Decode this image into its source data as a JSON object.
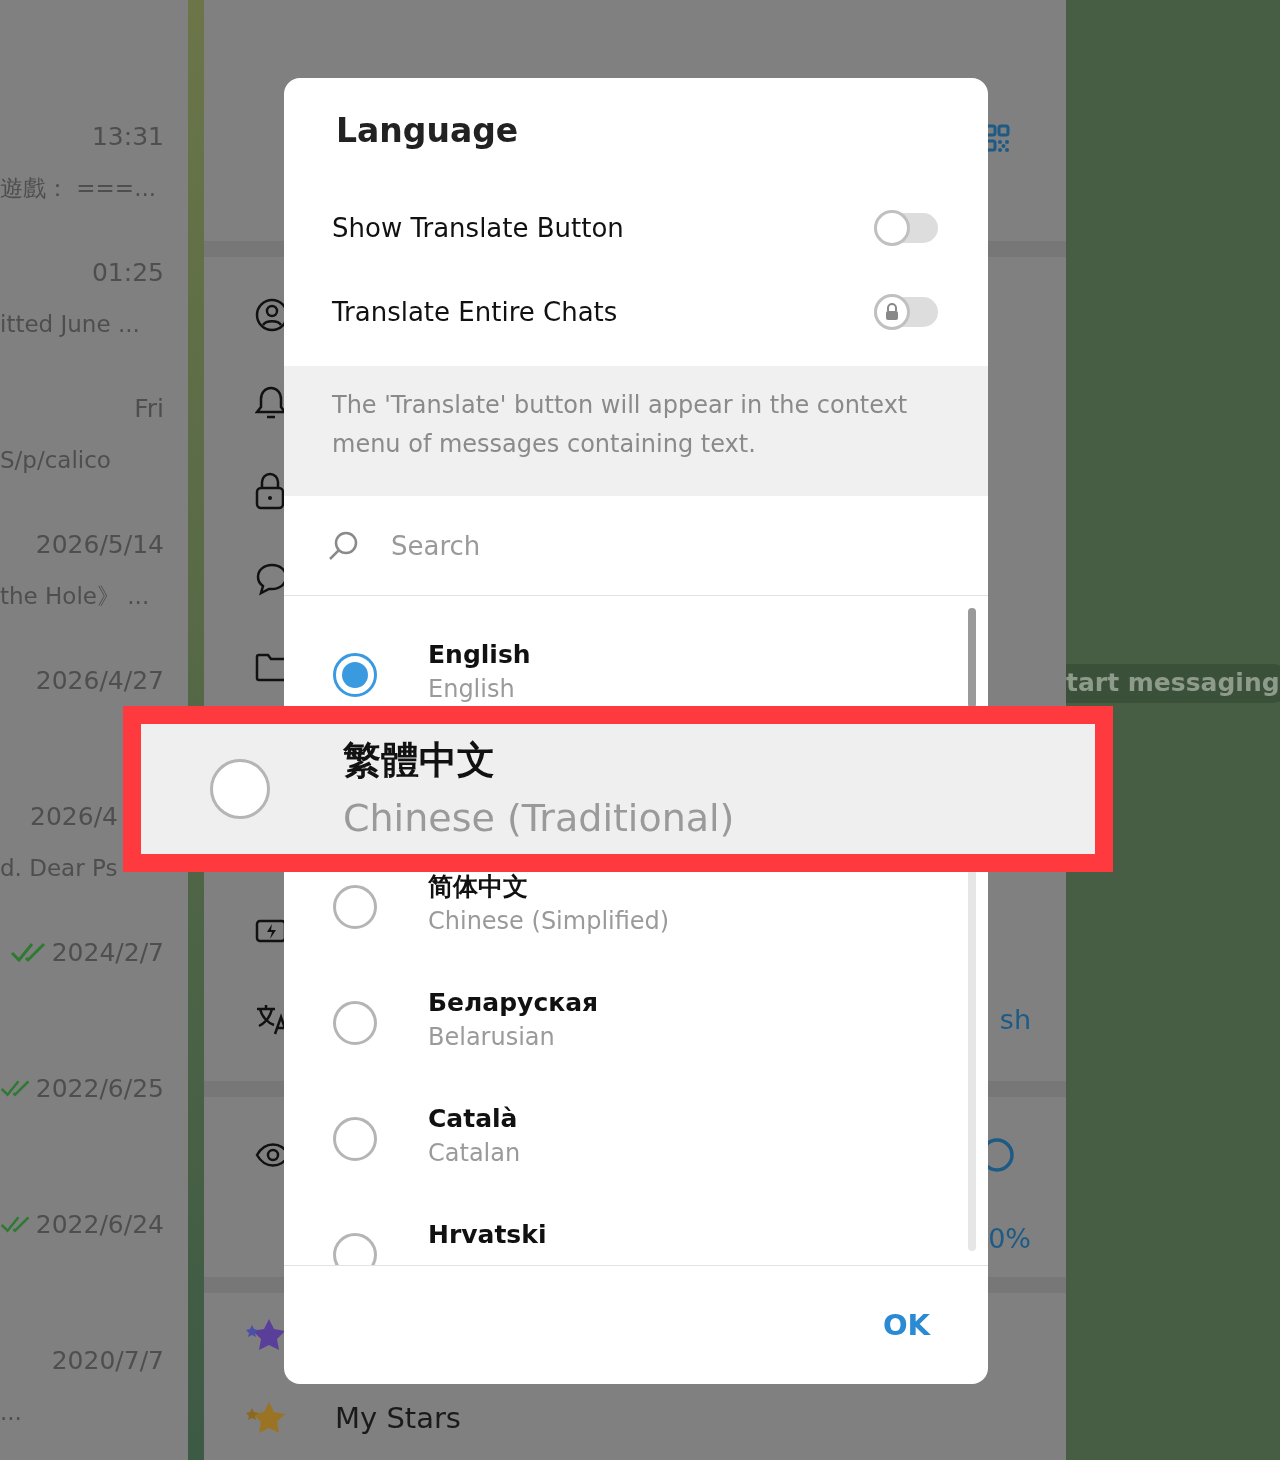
{
  "chat_list": {
    "items": [
      {
        "time": "13:31",
        "snippet": "遊戲： ===...",
        "read": false
      },
      {
        "time": "01:25",
        "snippet": "itted June ...",
        "read": false
      },
      {
        "time": "Fri",
        "snippet": "S/p/calico",
        "read": false
      },
      {
        "time": "2026/5/14",
        "snippet": "the Hole》 ...",
        "read": false
      },
      {
        "time": "2026/4/27",
        "read": false
      },
      {
        "time": "2026/4",
        "snippet": "d. Dear Ps",
        "read": false,
        "clipped": true
      },
      {
        "time": "2024/2/7",
        "read": true
      },
      {
        "time": "2022/6/25",
        "read": true
      },
      {
        "time": "2022/6/24",
        "read": true
      },
      {
        "time": "2020/7/7",
        "snippet": "...",
        "read": false
      }
    ]
  },
  "settings_panel": {
    "language_row_value": "sh",
    "percent_row_value": "0%",
    "stars_item": {
      "label": "My Stars"
    }
  },
  "chat_area": {
    "hint": "tart messaging"
  },
  "dialog": {
    "title": "Language",
    "toggles": [
      {
        "label": "Show Translate Button",
        "on": false,
        "locked": false
      },
      {
        "label": "Translate Entire Chats",
        "on": false,
        "locked": true
      }
    ],
    "info": "The 'Translate' button will appear in the context menu of messages containing text.",
    "search": {
      "placeholder": "Search"
    },
    "languages": [
      {
        "name": "English",
        "english_name": "English",
        "selected": true,
        "highlighted": false
      },
      {
        "name": "繁體中文",
        "english_name": "Chinese (Traditional)",
        "selected": false,
        "highlighted": true
      },
      {
        "name": "简体中文",
        "english_name": "Chinese (Simplified)",
        "selected": false,
        "highlighted": false
      },
      {
        "name": "Беларуская",
        "english_name": "Belarusian",
        "selected": false,
        "highlighted": false
      },
      {
        "name": "Català",
        "english_name": "Catalan",
        "selected": false,
        "highlighted": false
      },
      {
        "name": "Hrvatski",
        "selected": false,
        "highlighted": false
      }
    ],
    "ok_button": "OK"
  }
}
